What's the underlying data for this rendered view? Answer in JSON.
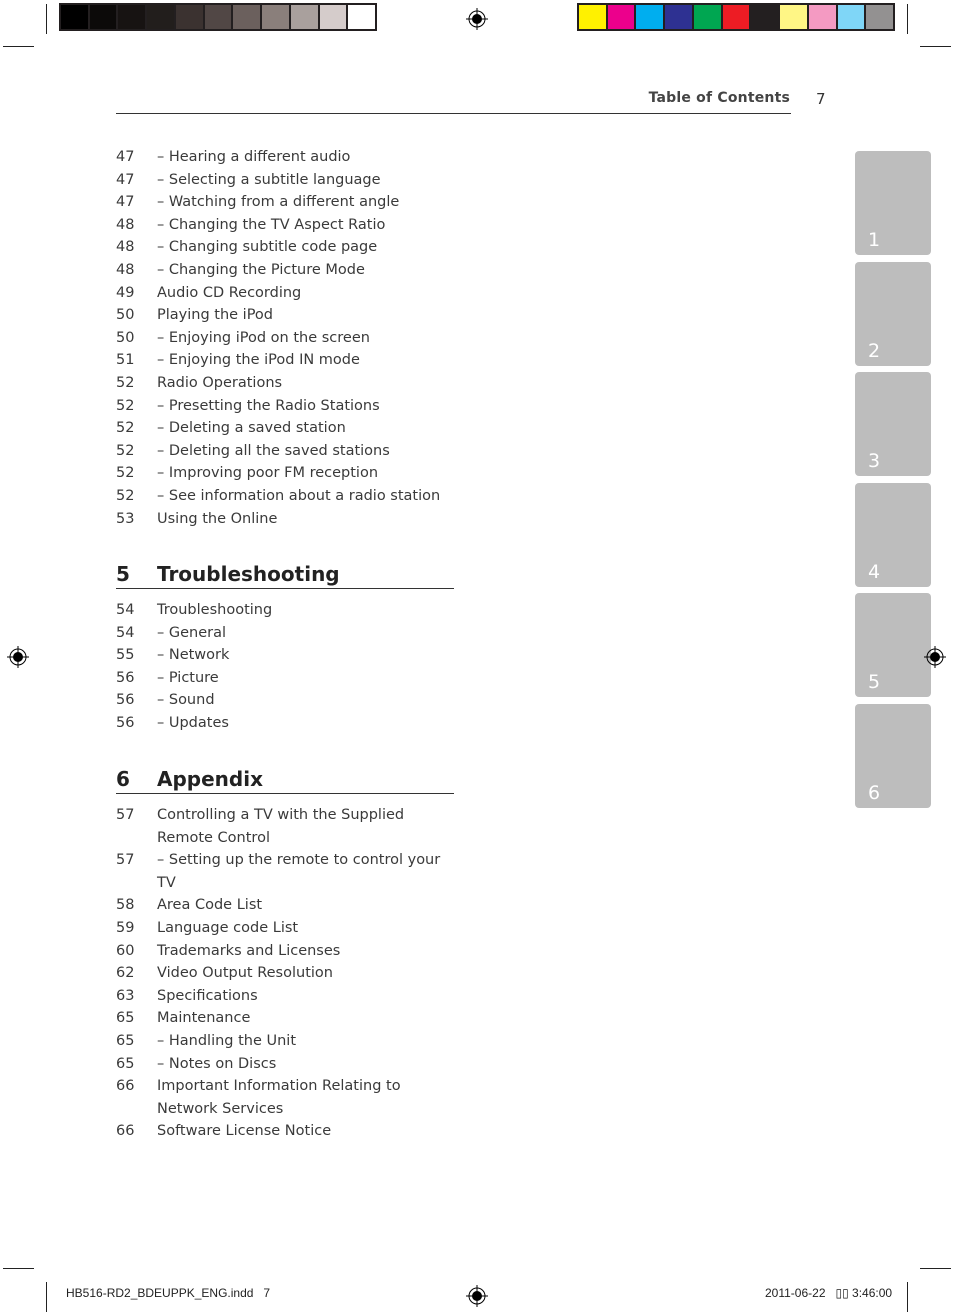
{
  "print_marks": {
    "grayscale_bar": [
      "#000000",
      "#0c0a09",
      "#171312",
      "#221e1c",
      "#3b3230",
      "#514745",
      "#6b605d",
      "#8a7f7b",
      "#a9a09d",
      "#d5cccb",
      "#ffffff"
    ],
    "color_bar": [
      "#fff100",
      "#ec008c",
      "#00aeef",
      "#2e3192",
      "#00a651",
      "#ed1c24",
      "#231f20",
      "#fff685",
      "#f49ac2",
      "#7fd6f7",
      "#939191"
    ]
  },
  "header": {
    "title": "Table of Contents",
    "page_number": "7"
  },
  "toc_continued": [
    {
      "page": "47",
      "title": "–  Hearing a different audio"
    },
    {
      "page": "47",
      "title": "–  Selecting a subtitle language"
    },
    {
      "page": "47",
      "title": "–  Watching from a different angle"
    },
    {
      "page": "48",
      "title": "–  Changing the TV Aspect Ratio"
    },
    {
      "page": "48",
      "title": "–  Changing subtitle code page"
    },
    {
      "page": "48",
      "title": "–  Changing the Picture Mode"
    },
    {
      "page": "49",
      "title": "Audio CD Recording"
    },
    {
      "page": "50",
      "title": "Playing the iPod"
    },
    {
      "page": "50",
      "title": "–  Enjoying iPod on the screen"
    },
    {
      "page": "51",
      "title": "–  Enjoying the iPod IN mode"
    },
    {
      "page": "52",
      "title": "Radio Operations"
    },
    {
      "page": "52",
      "title": "–  Presetting the Radio Stations"
    },
    {
      "page": "52",
      "title": "–  Deleting a saved station"
    },
    {
      "page": "52",
      "title": "–  Deleting all the saved stations"
    },
    {
      "page": "52",
      "title": "–  Improving poor FM reception"
    },
    {
      "page": "52",
      "title": "–  See information about a radio station"
    },
    {
      "page": "53",
      "title": "Using the Online"
    }
  ],
  "sections": [
    {
      "number": "5",
      "title": "Troubleshooting",
      "entries": [
        {
          "page": "54",
          "title": "Troubleshooting"
        },
        {
          "page": "54",
          "title": "–  General"
        },
        {
          "page": "55",
          "title": "–  Network"
        },
        {
          "page": "56",
          "title": "–  Picture"
        },
        {
          "page": "56",
          "title": "–  Sound"
        },
        {
          "page": "56",
          "title": "–  Updates"
        }
      ]
    },
    {
      "number": "6",
      "title": "Appendix",
      "entries": [
        {
          "page": "57",
          "title": "Controlling a TV with the Supplied Remote Control"
        },
        {
          "page": "57",
          "title": "–  Setting up the remote to control your TV"
        },
        {
          "page": "58",
          "title": "Area Code List"
        },
        {
          "page": "59",
          "title": "Language code List"
        },
        {
          "page": "60",
          "title": "Trademarks and Licenses"
        },
        {
          "page": "62",
          "title": "Video Output Resolution"
        },
        {
          "page": "63",
          "title": "Specifications"
        },
        {
          "page": "65",
          "title": "Maintenance"
        },
        {
          "page": "65",
          "title": "–  Handling the Unit"
        },
        {
          "page": "65",
          "title": "–  Notes on Discs"
        },
        {
          "page": "66",
          "title": "Important Information Relating to Network Services"
        },
        {
          "page": "66",
          "title": "Software License Notice"
        }
      ]
    }
  ],
  "chapter_tabs": [
    "1",
    "2",
    "3",
    "4",
    "5",
    "6"
  ],
  "footer": {
    "file": "HB516-RD2_BDEUPPK_ENG.indd   7",
    "timestamp": "2011-06-22   ▯▯ 3:46:00"
  },
  "colors": {
    "tab_gray": "#bdbdbd",
    "text": "#3a3a3a"
  }
}
